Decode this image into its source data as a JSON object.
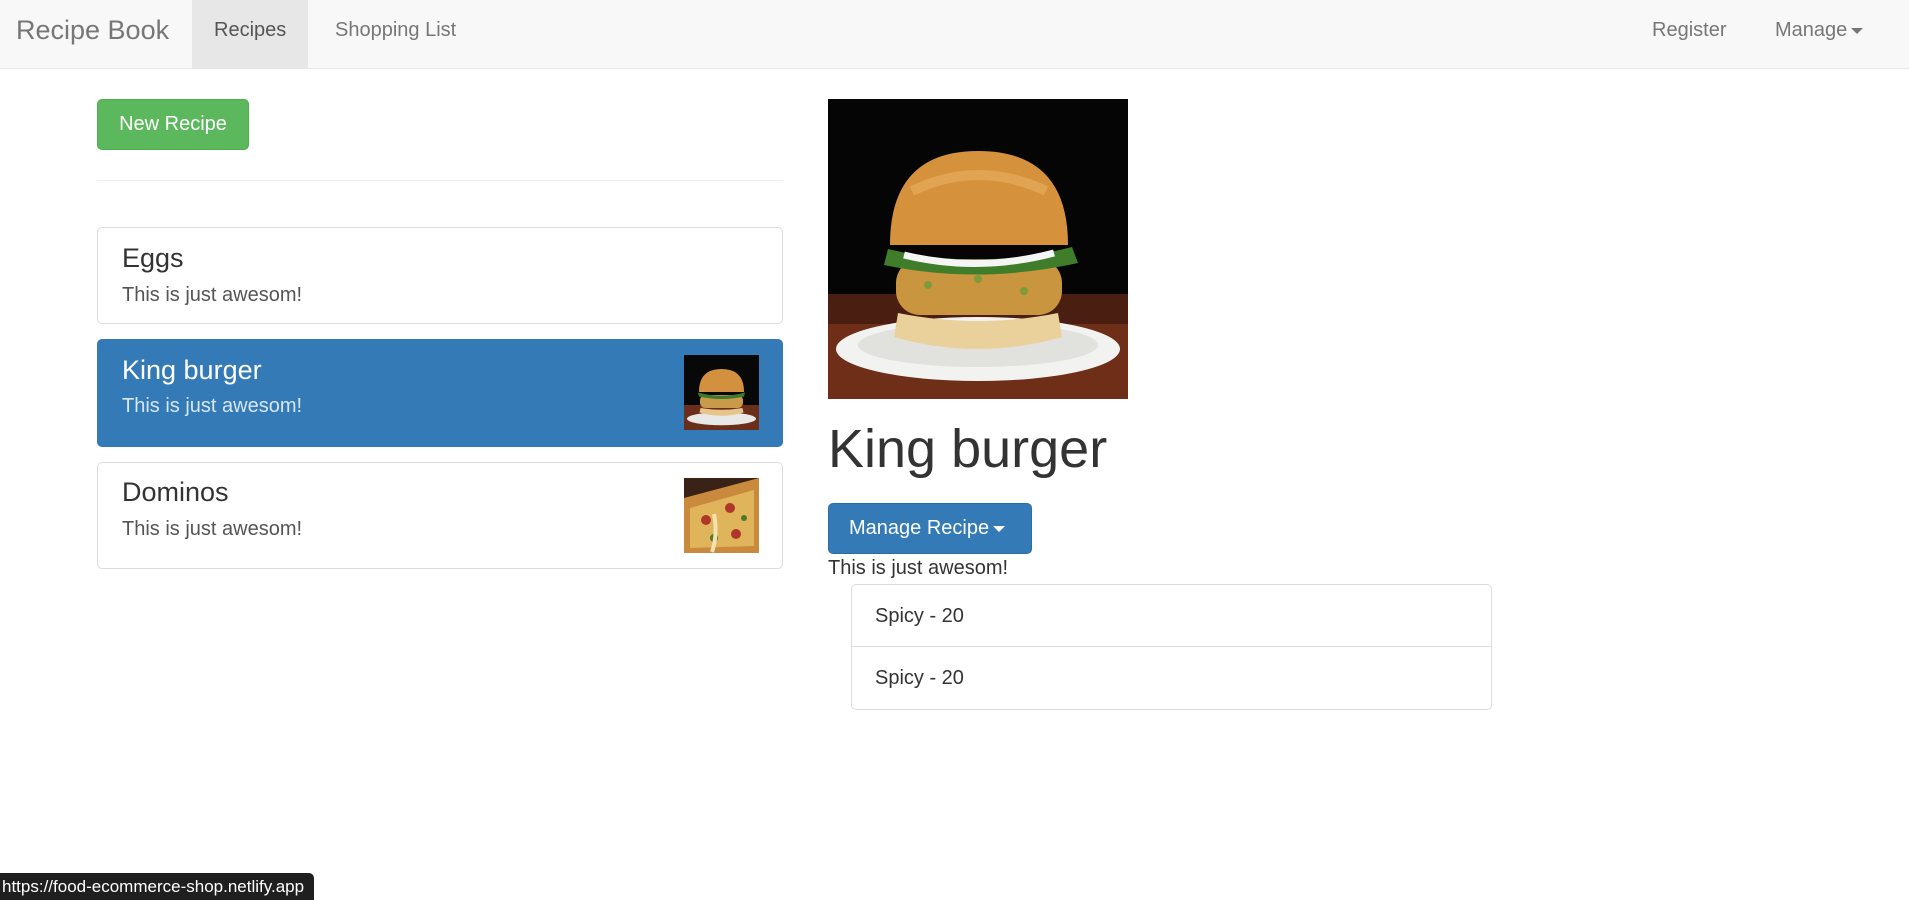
{
  "navbar": {
    "brand": "Recipe Book",
    "links": [
      "Recipes",
      "Shopping List"
    ],
    "right_links": [
      "Register",
      "Manage"
    ]
  },
  "sidebar": {
    "new_recipe_label": "New Recipe",
    "recipes": [
      {
        "name": "Eggs",
        "description": "This is just awesom!"
      },
      {
        "name": "King burger",
        "description": "This is just awesom!"
      },
      {
        "name": "Dominos",
        "description": "This is just awesom!"
      }
    ]
  },
  "detail": {
    "title": "King burger",
    "manage_label": "Manage Recipe",
    "description": "This is just awesom!",
    "ingredients": [
      "Spicy - 20",
      "Spicy - 20"
    ]
  },
  "status_bar": {
    "url": "https://food-ecommerce-shop.netlify.app"
  },
  "colors": {
    "success": "#5cb85c",
    "primary": "#337ab7",
    "navbar_bg": "#f8f8f8"
  }
}
